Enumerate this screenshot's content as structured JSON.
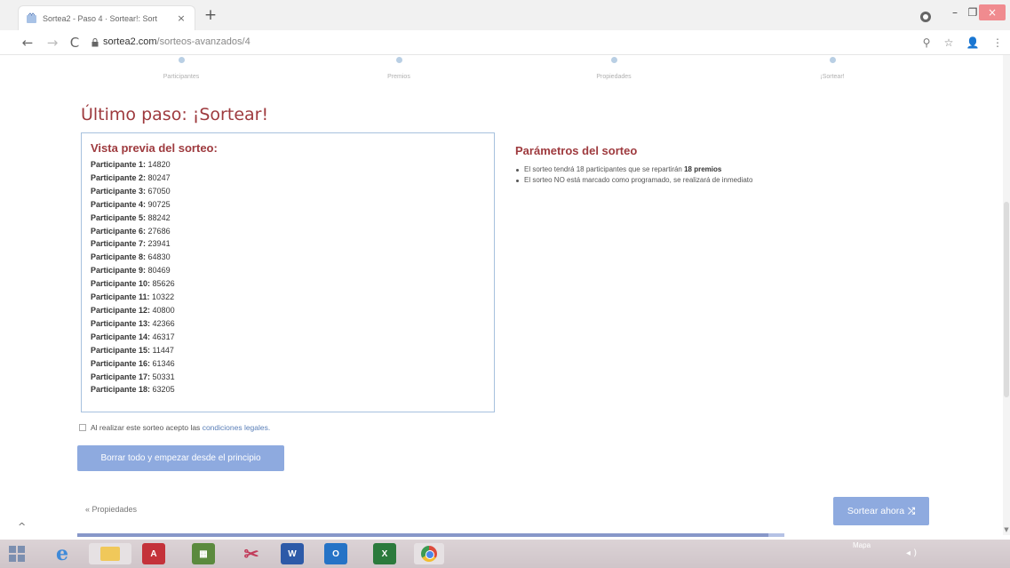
{
  "browser": {
    "tab_title": "Sortea2 - Paso 4 · Sortear!: Sort",
    "tab_close": "×",
    "new_tab": "+",
    "url_host": "sortea2.com",
    "url_path": "/sorteos-avanzados/4"
  },
  "steps": [
    {
      "label": "Participantes"
    },
    {
      "label": "Premios"
    },
    {
      "label": "Propiedades"
    },
    {
      "label": "¡Sortear!"
    }
  ],
  "page": {
    "heading": "Último paso: ¡Sortear!",
    "preview_title": "Vista previa del sorteo:",
    "participants": [
      {
        "label": "Participante 1:",
        "value": "14820"
      },
      {
        "label": "Participante 2:",
        "value": "80247"
      },
      {
        "label": "Participante 3:",
        "value": "67050"
      },
      {
        "label": "Participante 4:",
        "value": "90725"
      },
      {
        "label": "Participante 5:",
        "value": "88242"
      },
      {
        "label": "Participante 6:",
        "value": "27686"
      },
      {
        "label": "Participante 7:",
        "value": "23941"
      },
      {
        "label": "Participante 8:",
        "value": "64830"
      },
      {
        "label": "Participante 9:",
        "value": "80469"
      },
      {
        "label": "Participante 10:",
        "value": "85626"
      },
      {
        "label": "Participante 11:",
        "value": "10322"
      },
      {
        "label": "Participante 12:",
        "value": "40800"
      },
      {
        "label": "Participante 13:",
        "value": "42366"
      },
      {
        "label": "Participante 14:",
        "value": "46317"
      },
      {
        "label": "Participante 15:",
        "value": "11447"
      },
      {
        "label": "Participante 16:",
        "value": "61346"
      },
      {
        "label": "Participante 17:",
        "value": "50331"
      },
      {
        "label": "Participante 18:",
        "value": "63205"
      }
    ],
    "params_title": "Parámetros del sorteo",
    "params_line1_pre": "El sorteo tendrá 18 participantes que se repartirán ",
    "params_line1_bold": "18 premios",
    "params_line2": "El sorteo NO está marcado como programado, se realizará de inmediato",
    "terms_text": "Al realizar este sorteo acepto las ",
    "terms_link": "condiciones legales.",
    "reset_button": "Borrar todo y empezar desde el principio",
    "back_link": "« Propiedades",
    "draw_button": "Sortear ahora"
  },
  "taskbar": {
    "tray_text": "Mapa",
    "clock": "",
    "word_label": "W",
    "outlook_label": "O",
    "excel_label": "X"
  },
  "colors": {
    "accent_red": "#9e3a3e",
    "button_blue": "#8eaadf",
    "box_border": "#a7c1de"
  }
}
